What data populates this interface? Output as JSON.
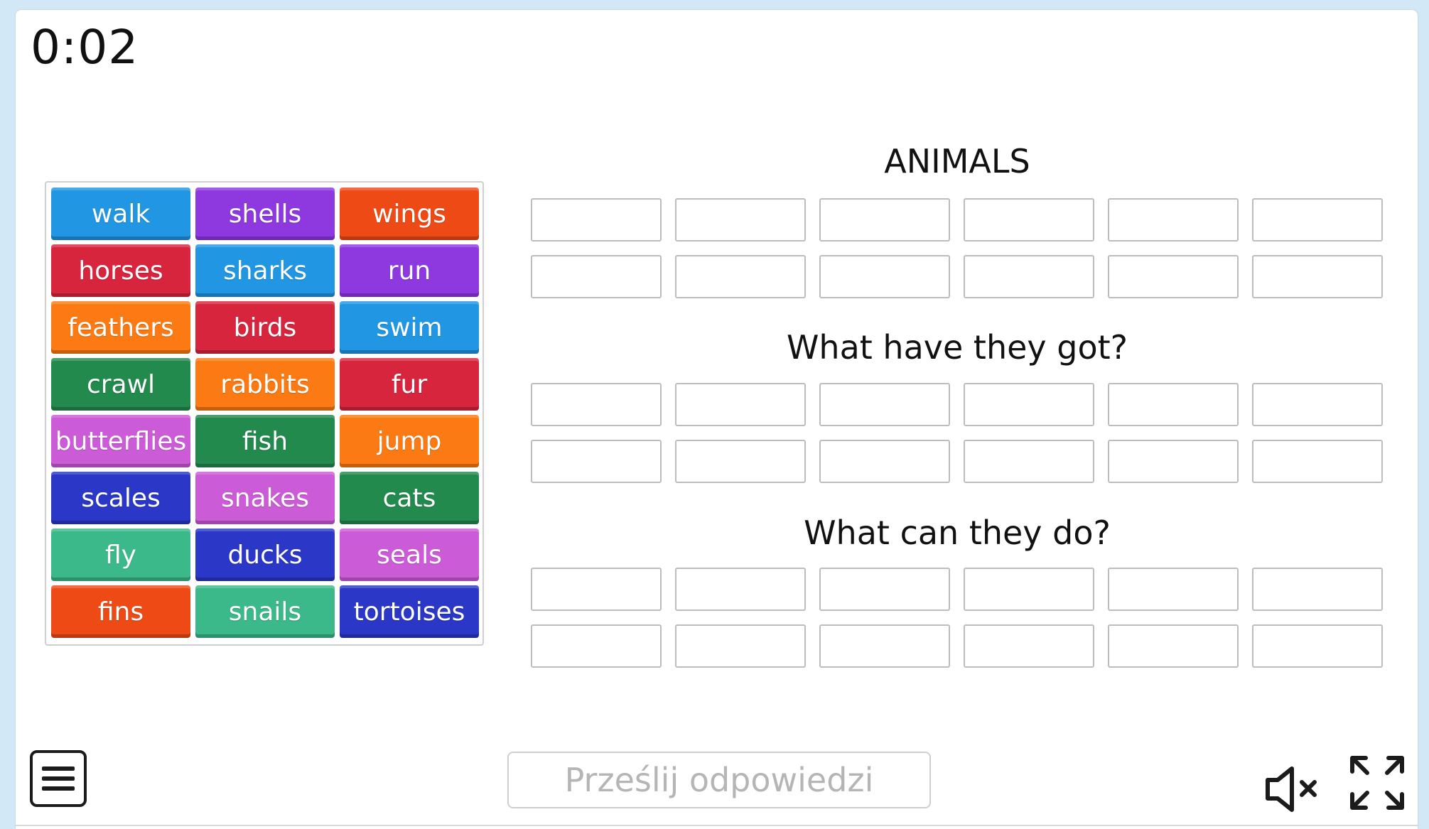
{
  "timer": "0:02",
  "tiles": [
    {
      "label": "walk",
      "color": "#2196e3"
    },
    {
      "label": "shells",
      "color": "#8e38e0"
    },
    {
      "label": "wings",
      "color": "#ee4a16"
    },
    {
      "label": "horses",
      "color": "#d8253e"
    },
    {
      "label": "sharks",
      "color": "#2196e3"
    },
    {
      "label": "run",
      "color": "#8e38e0"
    },
    {
      "label": "feathers",
      "color": "#fb7a14"
    },
    {
      "label": "birds",
      "color": "#d8253e"
    },
    {
      "label": "swim",
      "color": "#2196e3"
    },
    {
      "label": "crawl",
      "color": "#238a4e"
    },
    {
      "label": "rabbits",
      "color": "#fb7a14"
    },
    {
      "label": "fur",
      "color": "#d8253e"
    },
    {
      "label": "butterflies",
      "color": "#cc5bd8"
    },
    {
      "label": "fish",
      "color": "#238a4e"
    },
    {
      "label": "jump",
      "color": "#fb7a14"
    },
    {
      "label": "scales",
      "color": "#2a37c7"
    },
    {
      "label": "snakes",
      "color": "#cc5bd8"
    },
    {
      "label": "cats",
      "color": "#238a4e"
    },
    {
      "label": "fly",
      "color": "#3cb98a"
    },
    {
      "label": "ducks",
      "color": "#2a37c7"
    },
    {
      "label": "seals",
      "color": "#cc5bd8"
    },
    {
      "label": "fins",
      "color": "#ee4a16"
    },
    {
      "label": "snails",
      "color": "#3cb98a"
    },
    {
      "label": "tortoises",
      "color": "#2a37c7"
    }
  ],
  "groups": [
    {
      "title": "ANIMALS"
    },
    {
      "title": "What have they got?"
    },
    {
      "title": "What can they do?"
    }
  ],
  "submit_label": "Prześlij odpowiedzi",
  "icons": {
    "menu": "menu-icon",
    "sound": "speaker-muted-icon",
    "fullscreen": "fullscreen-icon"
  }
}
